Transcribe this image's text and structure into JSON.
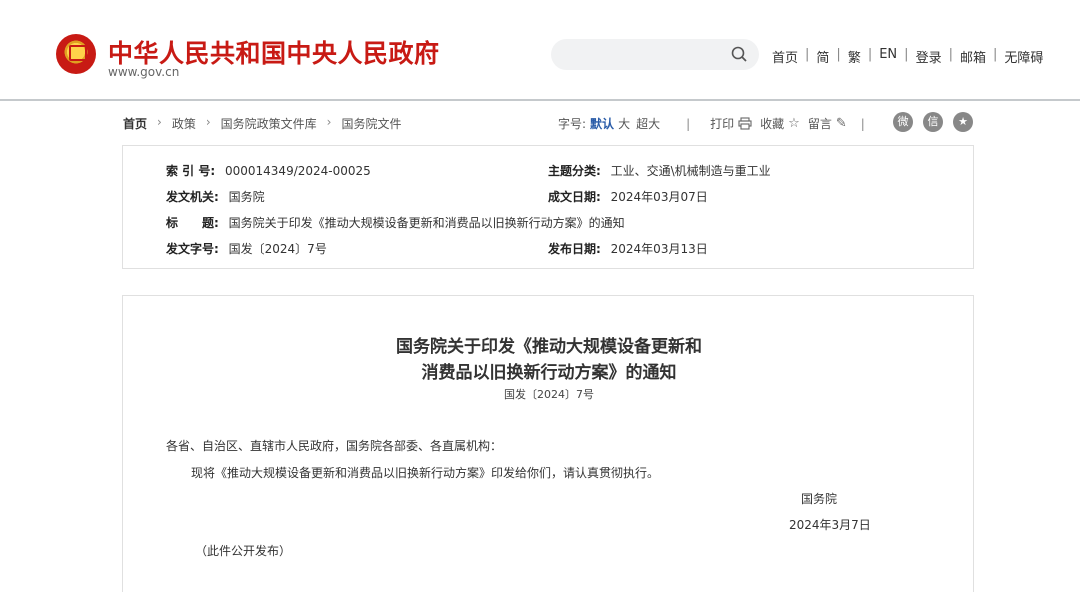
{
  "header": {
    "site_title": "中华人民共和国中央人民政府",
    "site_url": "www.gov.cn",
    "search": {
      "placeholder": ""
    },
    "nav": [
      "首页",
      "简",
      "繁",
      "EN",
      "登录",
      "邮箱",
      "无障碍"
    ]
  },
  "breadcrumb": {
    "items": [
      "首页",
      "政策",
      "国务院政策文件库",
      "国务院文件"
    ]
  },
  "tools": {
    "font_size_label": "字号:",
    "font_default": "默认",
    "font_large": "大",
    "font_xlarge": "超大",
    "print": "打印",
    "favorite": "收藏",
    "comment": "留言",
    "social": [
      "weibo-icon",
      "wechat-icon",
      "favorite-star-icon"
    ]
  },
  "meta": {
    "index_label": "索 引 号:",
    "index_value": "000014349/2024-00025",
    "category_label": "主题分类:",
    "category_value": "工业、交通\\机械制造与重工业",
    "issuer_label": "发文机关:",
    "issuer_value": "国务院",
    "written_date_label": "成文日期:",
    "written_date_value": "2024年03月07日",
    "title_label": "标　　题:",
    "title_value": "国务院关于印发《推动大规模设备更新和消费品以旧换新行动方案》的通知",
    "doc_no_label": "发文字号:",
    "doc_no_value": "国发〔2024〕7号",
    "publish_date_label": "发布日期:",
    "publish_date_value": "2024年03月13日"
  },
  "document": {
    "title_line1": "国务院关于印发《推动大规模设备更新和",
    "title_line2": "消费品以旧换新行动方案》的通知",
    "number": "国发〔2024〕7号",
    "addressee": "各省、自治区、直辖市人民政府，国务院各部委、各直属机构：",
    "body": "现将《推动大规模设备更新和消费品以旧换新行动方案》印发给你们，请认真贯彻执行。",
    "signatory": "国务院",
    "date": "2024年3月7日",
    "note": "（此件公开发布）"
  },
  "colors": {
    "brand_red": "#c81a14",
    "link_blue": "#2a5ca8"
  }
}
